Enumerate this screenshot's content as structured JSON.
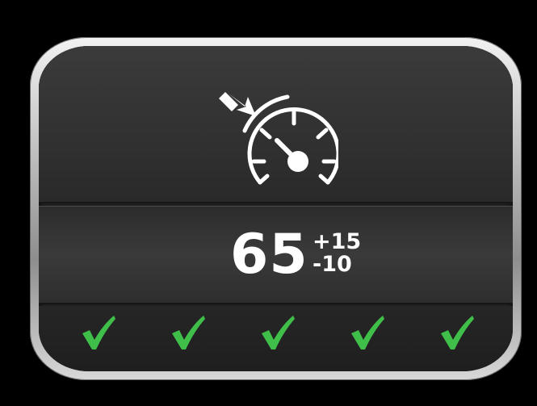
{
  "cruise_display": {
    "icon": "cruise-control-speedometer-icon",
    "set_speed": "65",
    "tolerance_upper": "+15",
    "tolerance_lower": "-10",
    "status_checks": [
      {
        "icon": "checkmark-icon",
        "state": "ok"
      },
      {
        "icon": "checkmark-icon",
        "state": "ok"
      },
      {
        "icon": "checkmark-icon",
        "state": "ok"
      },
      {
        "icon": "checkmark-icon",
        "state": "ok"
      },
      {
        "icon": "checkmark-icon",
        "state": "ok"
      }
    ]
  },
  "colors": {
    "background": "#000000",
    "screen": "#2b2b2b",
    "text": "#ffffff",
    "check": "#3fbf4a"
  }
}
